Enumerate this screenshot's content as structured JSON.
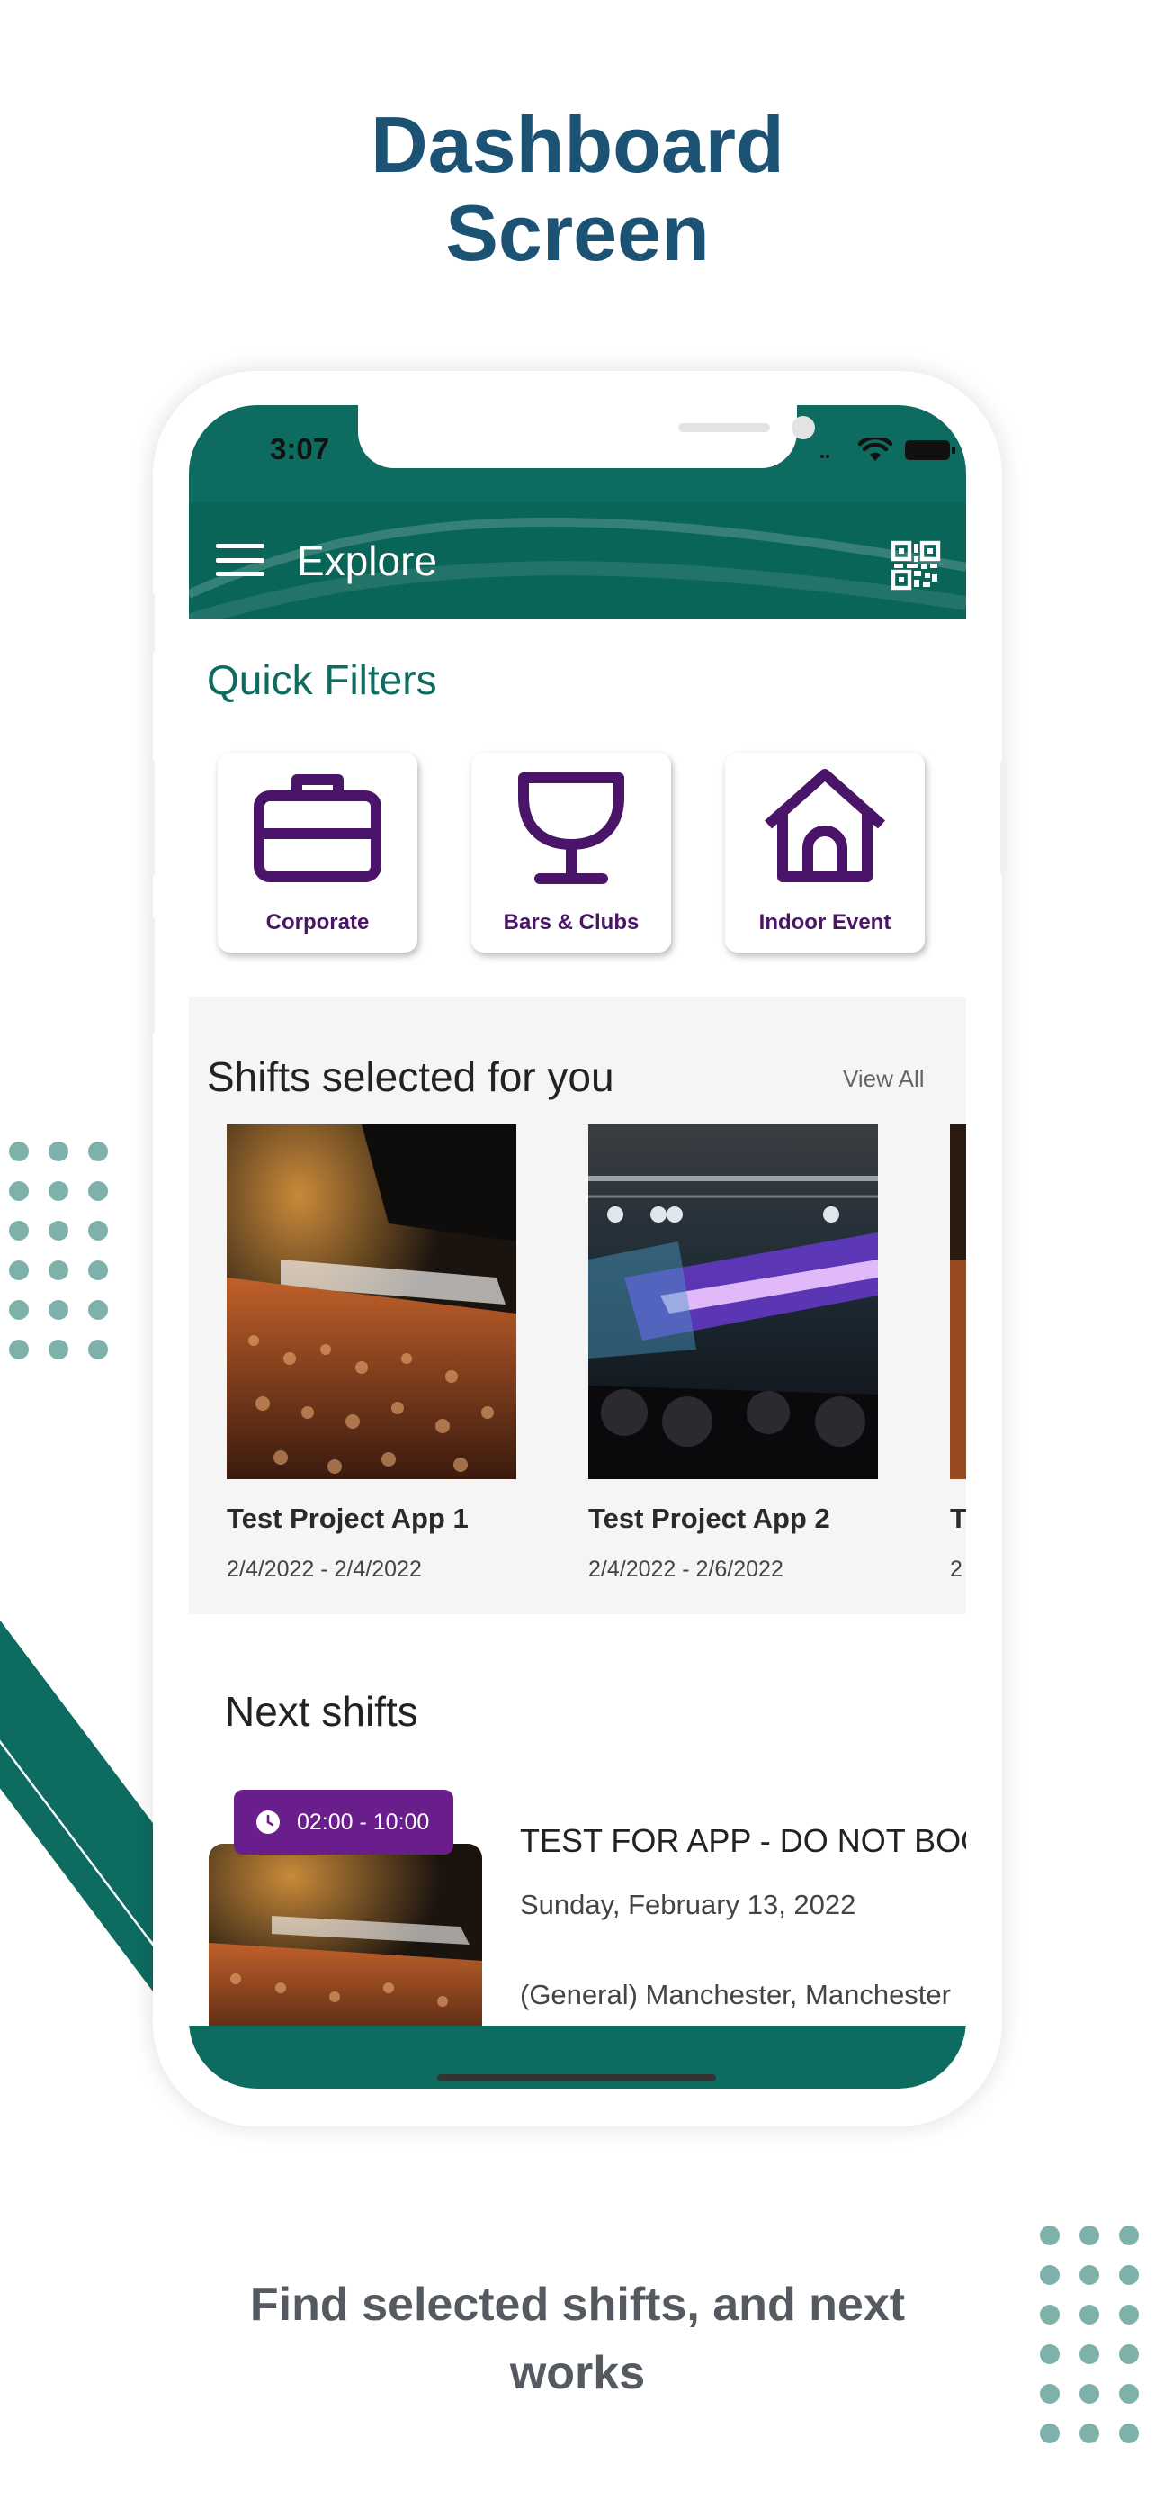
{
  "headline": {
    "line1": "Dashboard",
    "line2": "Screen"
  },
  "caption": {
    "line1": "Find selected shifts, and next",
    "line2": "works"
  },
  "status_bar": {
    "time": "3:07"
  },
  "app_bar": {
    "title": "Explore",
    "menu_icon": "hamburger-menu-icon",
    "qr_icon": "qr-code-icon"
  },
  "quick_filters": {
    "title": "Quick Filters",
    "items": [
      {
        "label": "Corporate",
        "icon": "briefcase-icon"
      },
      {
        "label": "Bars & Clubs",
        "icon": "wine-glass-icon"
      },
      {
        "label": "Indoor Event",
        "icon": "house-icon"
      }
    ]
  },
  "shifts_for_you": {
    "title": "Shifts selected for you",
    "view_all": "View All",
    "items": [
      {
        "name": "Test Project App 1",
        "dates": "2/4/2022 - 2/4/2022"
      },
      {
        "name": "Test Project App 2",
        "dates": "2/4/2022 - 2/6/2022"
      },
      {
        "name": "T",
        "dates": "2"
      }
    ]
  },
  "next_shifts": {
    "title": "Next shifts",
    "items": [
      {
        "time": "02:00 - 10:00",
        "name": "TEST FOR APP - DO NOT BOOK",
        "date": "Sunday, February 13, 2022",
        "location": "(General) Manchester, Manchester"
      }
    ]
  },
  "colors": {
    "brand_teal": "#0d6b5f",
    "accent_purple": "#4a1468",
    "badge_purple": "#6a1e8c",
    "headline_blue": "#1c5274"
  }
}
